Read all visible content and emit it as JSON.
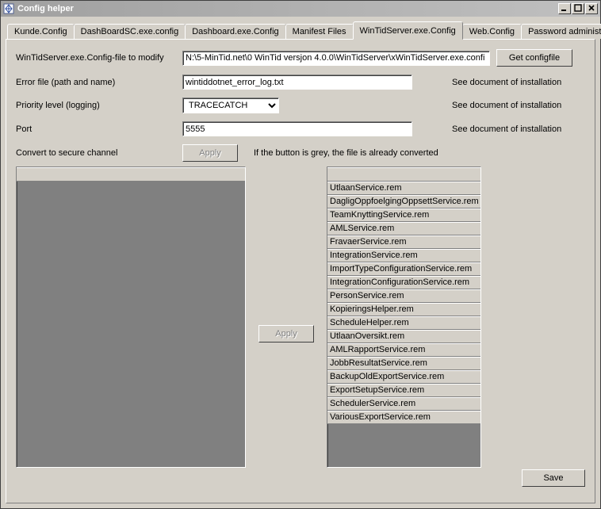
{
  "window": {
    "title": "Config helper"
  },
  "tabs": [
    {
      "label": "Kunde.Config"
    },
    {
      "label": "DashBoardSC.exe.config"
    },
    {
      "label": "Dashboard.exe.Config"
    },
    {
      "label": "Manifest Files"
    },
    {
      "label": "WinTidServer.exe.Config"
    },
    {
      "label": "Web.Config"
    },
    {
      "label": "Password administration"
    }
  ],
  "form": {
    "config_file_label": "WinTidServer.exe.Config-file to modify",
    "config_file_value": "N:\\5-MinTid.net\\0 WinTid versjon 4.0.0\\WinTidServer\\xWinTidServer.exe.confi",
    "get_config_label": "Get configfile",
    "error_file_label": "Error file (path and name)",
    "error_file_value": "wintiddotnet_error_log.txt",
    "priority_label": "Priority level (logging)",
    "priority_value": "TRACECATCH",
    "port_label": "Port",
    "port_value": "5555",
    "doc_note": "See document of installation",
    "convert_label": "Convert to secure channel",
    "apply_label": "Apply",
    "convert_hint": "If the button is grey, the file is already converted",
    "save_label": "Save"
  },
  "services": [
    "UtlaanService.rem",
    "DagligOppfoelgingOppsettService.rem",
    "TeamKnyttingService.rem",
    "AMLService.rem",
    "FravaerService.rem",
    "IntegrationService.rem",
    "ImportTypeConfigurationService.rem",
    "IntegrationConfigurationService.rem",
    "PersonService.rem",
    "KopieringsHelper.rem",
    "ScheduleHelper.rem",
    "UtlaanOversikt.rem",
    "AMLRapportService.rem",
    "JobbResultatService.rem",
    "BackupOldExportService.rem",
    "ExportSetupService.rem",
    "SchedulerService.rem",
    "VariousExportService.rem"
  ]
}
